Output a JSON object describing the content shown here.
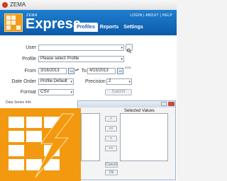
{
  "window": {
    "title": "ZEMA"
  },
  "header": {
    "brand_small": "ZEMA",
    "brand": "Express",
    "links": "LOGIN | ABOUT | HELP",
    "tabs": [
      "Profiles",
      "Reports",
      "Settings"
    ],
    "active_tab": "Profiles",
    "color": "#1a6fc0"
  },
  "form": {
    "user": {
      "label": "User",
      "value": ""
    },
    "profile": {
      "label": "Profile",
      "value": "Please select Profile"
    },
    "from": {
      "label": "From",
      "value": "3/16/2013",
      "cal_day": "15"
    },
    "to": {
      "label": "To",
      "value": "4/15/2013",
      "cal_day": "15",
      "extra": "EOD"
    },
    "date_order": {
      "label": "Date Order",
      "value": "Profile Default"
    },
    "precision": {
      "label": "Precision",
      "value": "2"
    },
    "format": {
      "label": "Format",
      "value": "CSV"
    },
    "submit_label": "Submit",
    "partial_label": "Data Series Info"
  },
  "dialog": {
    "selected_values_label": "Selected Values",
    "buttons": [
      ">",
      ">>",
      "<",
      "<<"
    ],
    "cancel_label": "Cancel",
    "ok_label": "Ok"
  },
  "colors": {
    "accent": "#f2990f",
    "header": "#0d5aa8"
  }
}
